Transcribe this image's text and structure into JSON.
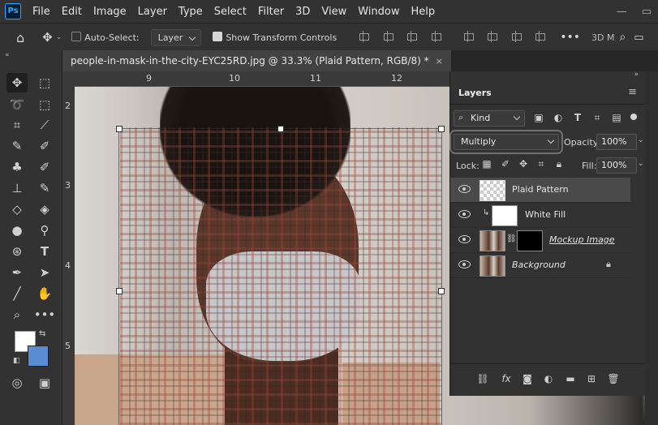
{
  "app": {
    "logo": "Ps"
  },
  "menu": [
    "File",
    "Edit",
    "Image",
    "Layer",
    "Type",
    "Select",
    "Filter",
    "3D",
    "View",
    "Window",
    "Help"
  ],
  "options": {
    "auto_select_label": "Auto-Select:",
    "auto_select_value": "Layer",
    "transform_label": "Show Transform Controls",
    "mode_3d_label": "3D M"
  },
  "document": {
    "tab_title": "people-in-mask-in-the-city-EYC25RD.jpg @ 33.3% (Plaid Pattern, RGB/8) *",
    "close_glyph": "×"
  },
  "rulers": {
    "top": [
      "9",
      "10",
      "11",
      "12"
    ],
    "left": [
      "2",
      "3",
      "4",
      "5"
    ]
  },
  "layers_panel": {
    "title": "Layers",
    "kind_label": "Kind",
    "blend_mode": "Multiply",
    "opacity_label": "Opacity:",
    "opacity_value": "100%",
    "lock_label": "Lock:",
    "fill_label": "Fill:",
    "fill_value": "100%",
    "layers": [
      {
        "name": "Plaid Pattern",
        "selected": true
      },
      {
        "name": "White Fill",
        "clipped": true
      },
      {
        "name": "Mockup Image",
        "italic": true,
        "underline": true
      },
      {
        "name": "Background",
        "italic": true,
        "locked": true
      }
    ],
    "footer_fx": "fx"
  },
  "colors": {
    "foreground": "#ffffff",
    "background": "#5b8bd0",
    "accent": "#31a8ff"
  }
}
